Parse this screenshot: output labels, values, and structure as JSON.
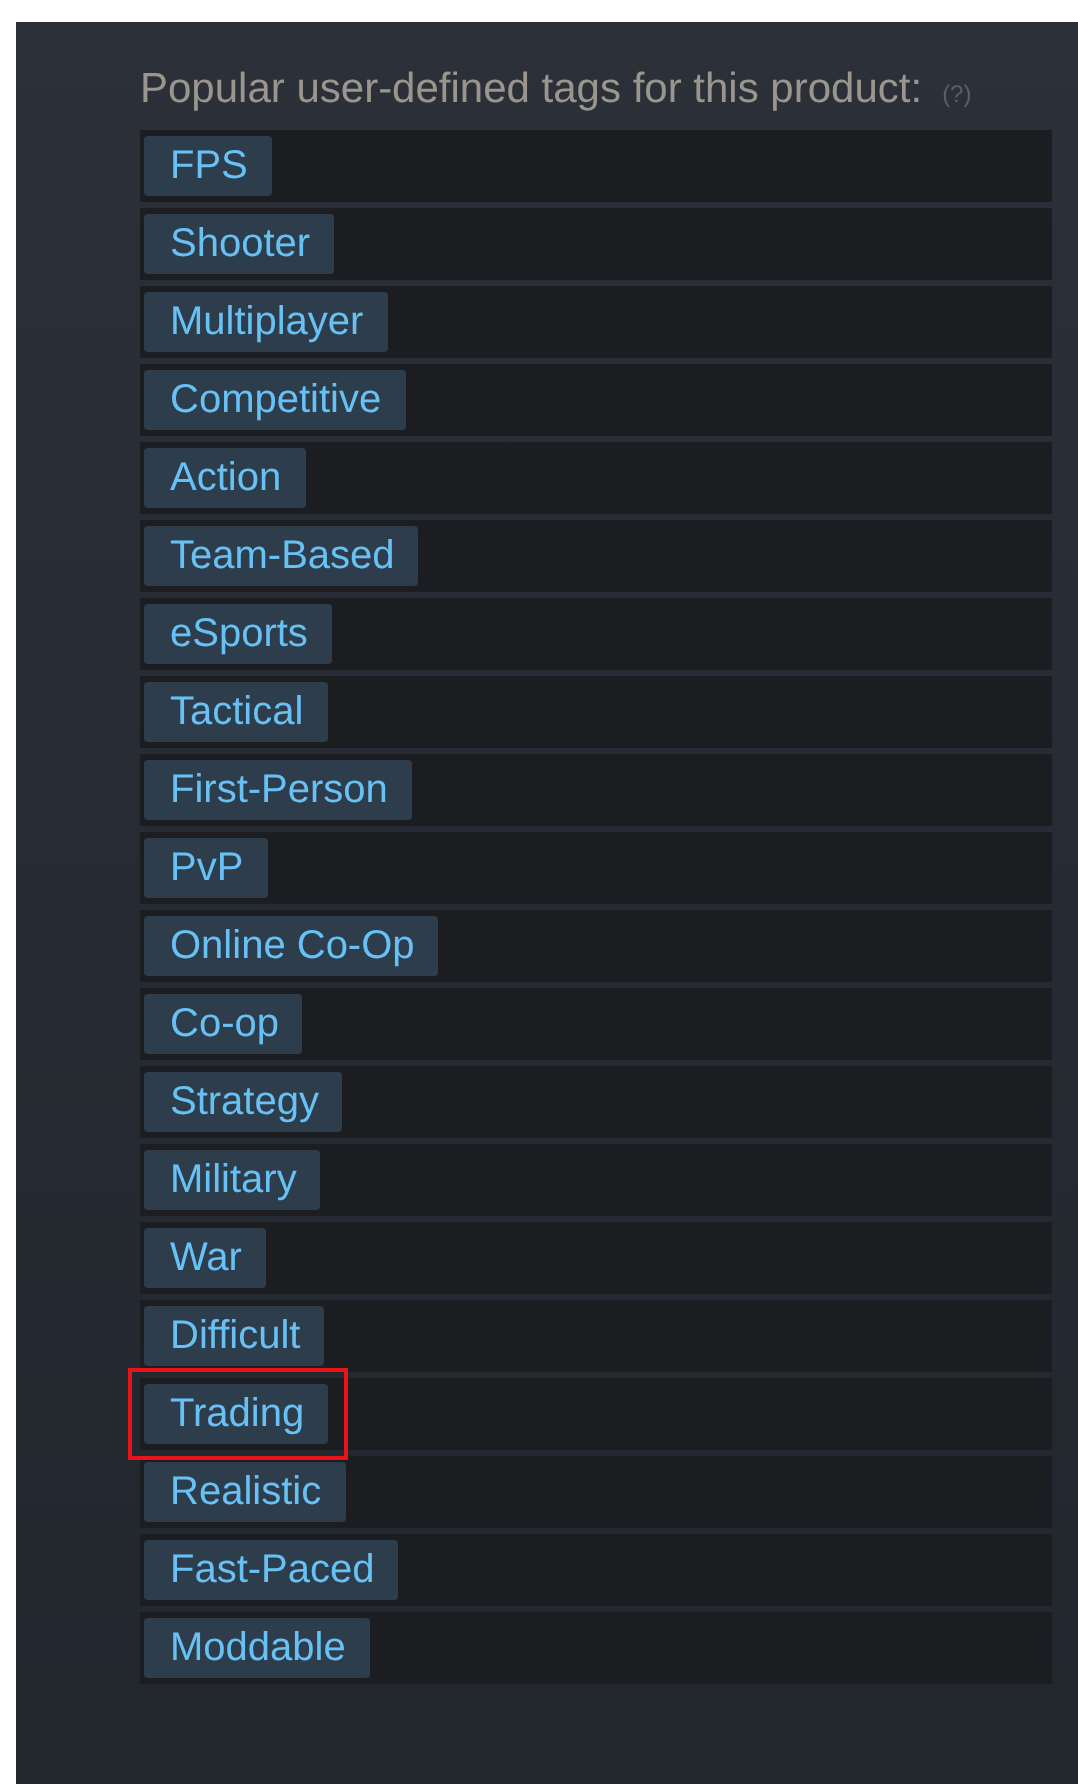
{
  "heading": "Popular user-defined tags for this product:",
  "help": "(?)",
  "tags": [
    {
      "label": "FPS",
      "highlighted": false
    },
    {
      "label": "Shooter",
      "highlighted": false
    },
    {
      "label": "Multiplayer",
      "highlighted": false
    },
    {
      "label": "Competitive",
      "highlighted": false
    },
    {
      "label": "Action",
      "highlighted": false
    },
    {
      "label": "Team-Based",
      "highlighted": false
    },
    {
      "label": "eSports",
      "highlighted": false
    },
    {
      "label": "Tactical",
      "highlighted": false
    },
    {
      "label": "First-Person",
      "highlighted": false
    },
    {
      "label": "PvP",
      "highlighted": false
    },
    {
      "label": "Online Co-Op",
      "highlighted": false
    },
    {
      "label": "Co-op",
      "highlighted": false
    },
    {
      "label": "Strategy",
      "highlighted": false
    },
    {
      "label": "Military",
      "highlighted": false
    },
    {
      "label": "War",
      "highlighted": false
    },
    {
      "label": "Difficult",
      "highlighted": false
    },
    {
      "label": "Trading",
      "highlighted": true
    },
    {
      "label": "Realistic",
      "highlighted": false
    },
    {
      "label": "Fast-Paced",
      "highlighted": false
    },
    {
      "label": "Moddable",
      "highlighted": false
    }
  ]
}
